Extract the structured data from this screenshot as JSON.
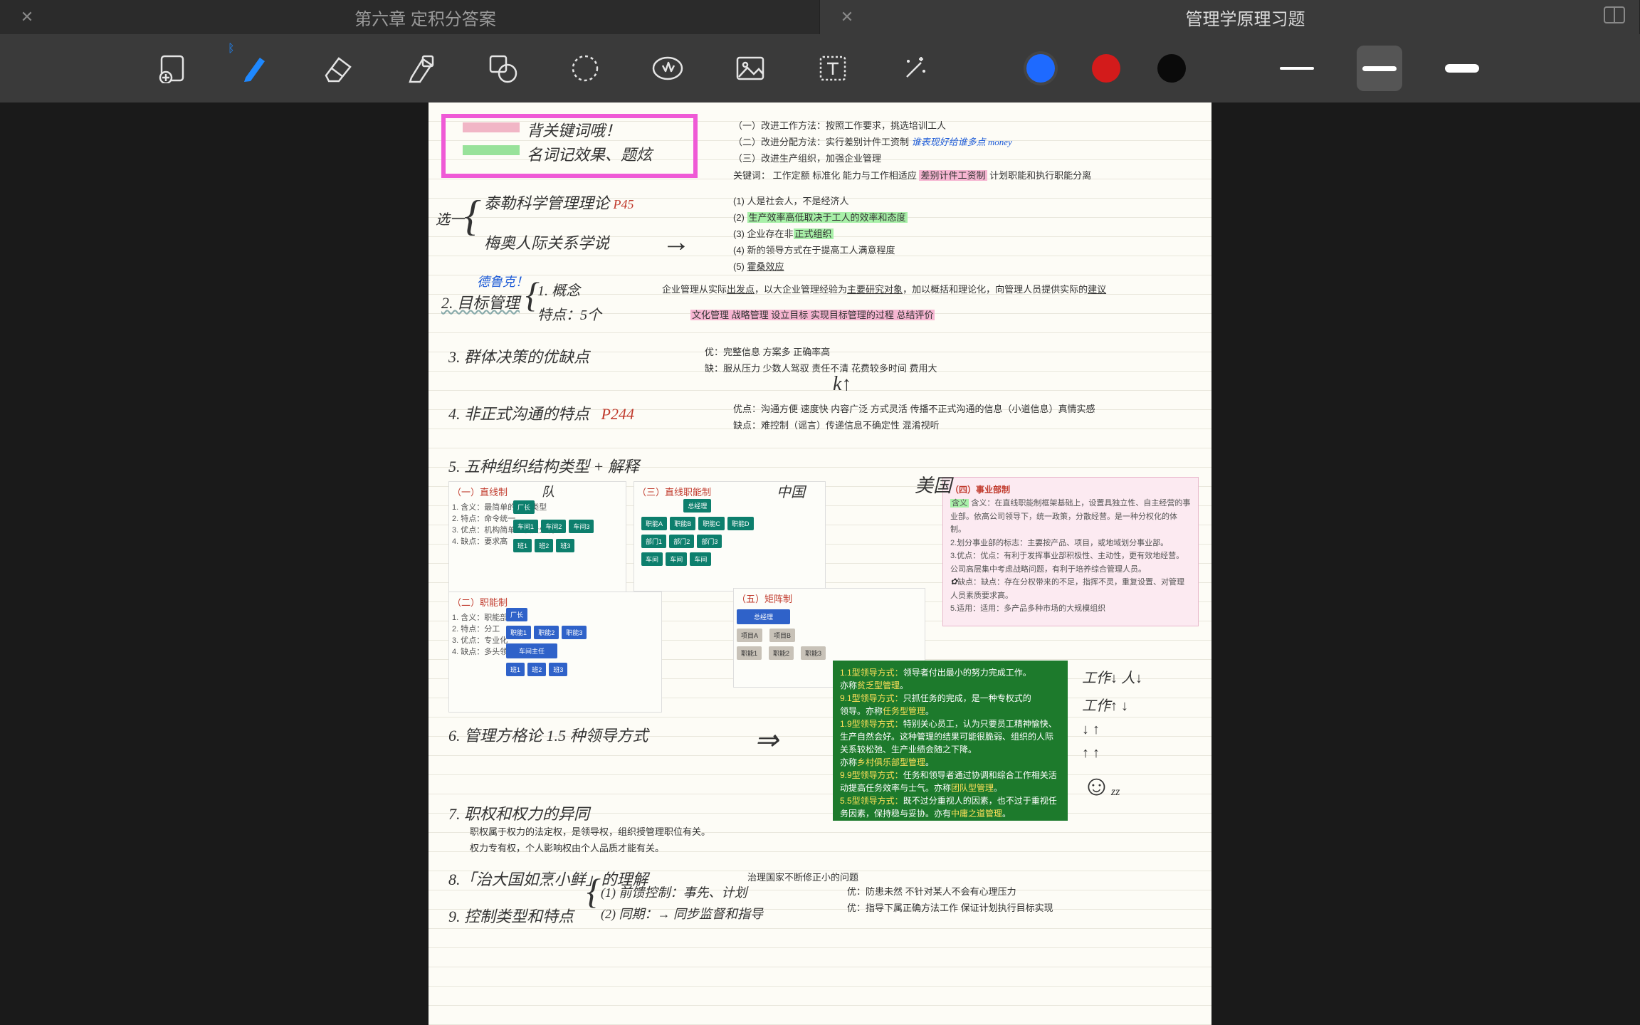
{
  "tabs": {
    "left": {
      "title": "第六章 定积分答案"
    },
    "right": {
      "title": "管理学原理习题"
    }
  },
  "toolbar": {
    "tools": [
      "add-image",
      "pen",
      "eraser",
      "highlighter",
      "shape",
      "lasso",
      "stamp",
      "photo",
      "text",
      "wand"
    ],
    "colors": {
      "blue": "#1e6aff",
      "red": "#d31b1b",
      "black": "#0a0a0a"
    }
  },
  "header": {
    "line1": "背关键词哦！",
    "line2": "名词记效果、题炫",
    "right": [
      "（一）改进工作方法：按照工作要求，挑选培训工人",
      "（二）改进分配方法：实行差别计件工资制",
      "（三）改进生产组织，加强企业管理"
    ],
    "right2_note": "谁表现好给谁多点 money",
    "kw_label": "关键词：",
    "kw_text": "工作定额 标准化 能力与工作相适应 差别计件工资制 计划职能和执行职能分离",
    "kw_hl": "差别计件工资制"
  },
  "s1": {
    "pick": "选一",
    "a": "泰勒科学管理理论",
    "a_page": "P45",
    "b": "梅奥人际关系学说",
    "points": [
      "(1) 人是社会人，不是经济人",
      "(2) 生产效率高低取决于工人的效率和态度",
      "(3) 企业存在非正式组织",
      "(4) 新的领导方式在于提高工人满意程度",
      "(5) 霍桑效应"
    ],
    "hl2": "生产效率高低取决于工人的效率和态度",
    "hl3": "正式组织"
  },
  "s2": {
    "tag": "德鲁克！",
    "title": "2. 目标管理",
    "sub1": "1. 概念",
    "sub2": "特点：5个",
    "concept": "企业管理从实际出发，以大企业管理经验为主要研究对象，加以概括和理论化，向管理人员提供实际的建议",
    "concept_hl1": "出发点",
    "concept_hl2": "主要研究对象",
    "concept_hl3": "建议",
    "feat": "文化管理 战略管理 设立目标 实现目标管理的过程 总结评价"
  },
  "s3": {
    "title": "3. 群体决策的优缺点",
    "adv_label": "优：",
    "adv": "完整信息 方案多 正确率高",
    "dis_label": "缺：",
    "dis": "服从压力 少数人驾驭 责任不清 花费较多时间 费用大"
  },
  "s4": {
    "title": "4. 非正式沟通的特点",
    "page": "P244",
    "adv_label": "优点：",
    "adv": "沟通方便 速度快 内容广泛 方式灵活 传播不正式沟通的信息（小道信息）真情实感",
    "dis_label": "缺点：",
    "dis": "难控制（谣言）传递信息不确定性 混淆视听"
  },
  "s5": {
    "title": "5. 五种组织结构类型 + 解释",
    "org1": "（一）直线制",
    "org1_note": "队",
    "org2": "（二）职能制",
    "org3": "（三）直线职能制",
    "org3_note": "中国",
    "org4": "（四）事业部制",
    "org4_note": "美国",
    "org5": "（五）矩阵制",
    "pinkpanel": {
      "t": "（四）事业部制",
      "l1": "含义：在直线职能制框架基础上，设置具独立性、自主经营的事业部。依高公司领导下，统一政策，分散经营。是一种分权化的体制。",
      "l2": "划分事业部的标志：主要按产品、项目，或地域划分事业部。",
      "l3": "优点：有利于发挥事业部积极性、主动性，更有效地经营。公司高层集中考虑战略问题，有利于培养综合管理人员。",
      "l4": "缺点：存在分权带来的不足，指挥不灵，重复设置、对管理人员素质要求高。",
      "l5": "适用：多产品多种市场的大规模组织"
    }
  },
  "s6": {
    "title": "6. 管理方格论 1.5 种领导方式",
    "green": {
      "a": "1.1型领导方式：领导者付出最小的努力完成工作。亦称贫乏型管理。",
      "b": "9.1型领导方式：只抓任务的完成，是一种专权式的管理。亦称任务型管理。",
      "c": "1.9型领导方式：特别关心员工，认为只要员工精神愉快、生产自然会好。这种管理的结果可能很脆弱，组织的人际关系较松弛、生产业绩会随之下降。亦称乡村俱乐部型管理。",
      "d": "5.5型领导方式：既不过分重视人的因素，也不过于重视任务因素，保持稳与妥协。亦有中庸之道管理。",
      "e": "9.9型领导方式：任务和领导者通过协调和综合工作相关活动提高任务效率与士气。亦称团队型管理。"
    },
    "grid": {
      "r1": "工作↓ 人↓",
      "r2": "工作↑ ↓",
      "r3": "↓ ↑",
      "r4": "↑ ↑"
    }
  },
  "s7": {
    "title": "7. 职权和权力的异同",
    "l1": "职权属于权力的法定权，是领导权，组织授管理职位有关。",
    "l2": "权力专有权，个人影响权由个人品质才能有关。"
  },
  "s8": {
    "title": "8.「治大国如烹小鲜」的理解",
    "note": "治理国家不断修正小的问题"
  },
  "s9": {
    "title": "9. 控制类型和特点",
    "a": "(1) 前馈控制：事先、计划",
    "a_adv": "优：防患未然  不针对某人不会有心理压力",
    "b": "(2) 同期：→ 同步监督和指导",
    "b_adv": "优：指导下属正确方法工作 保证计划执行目标实现"
  }
}
